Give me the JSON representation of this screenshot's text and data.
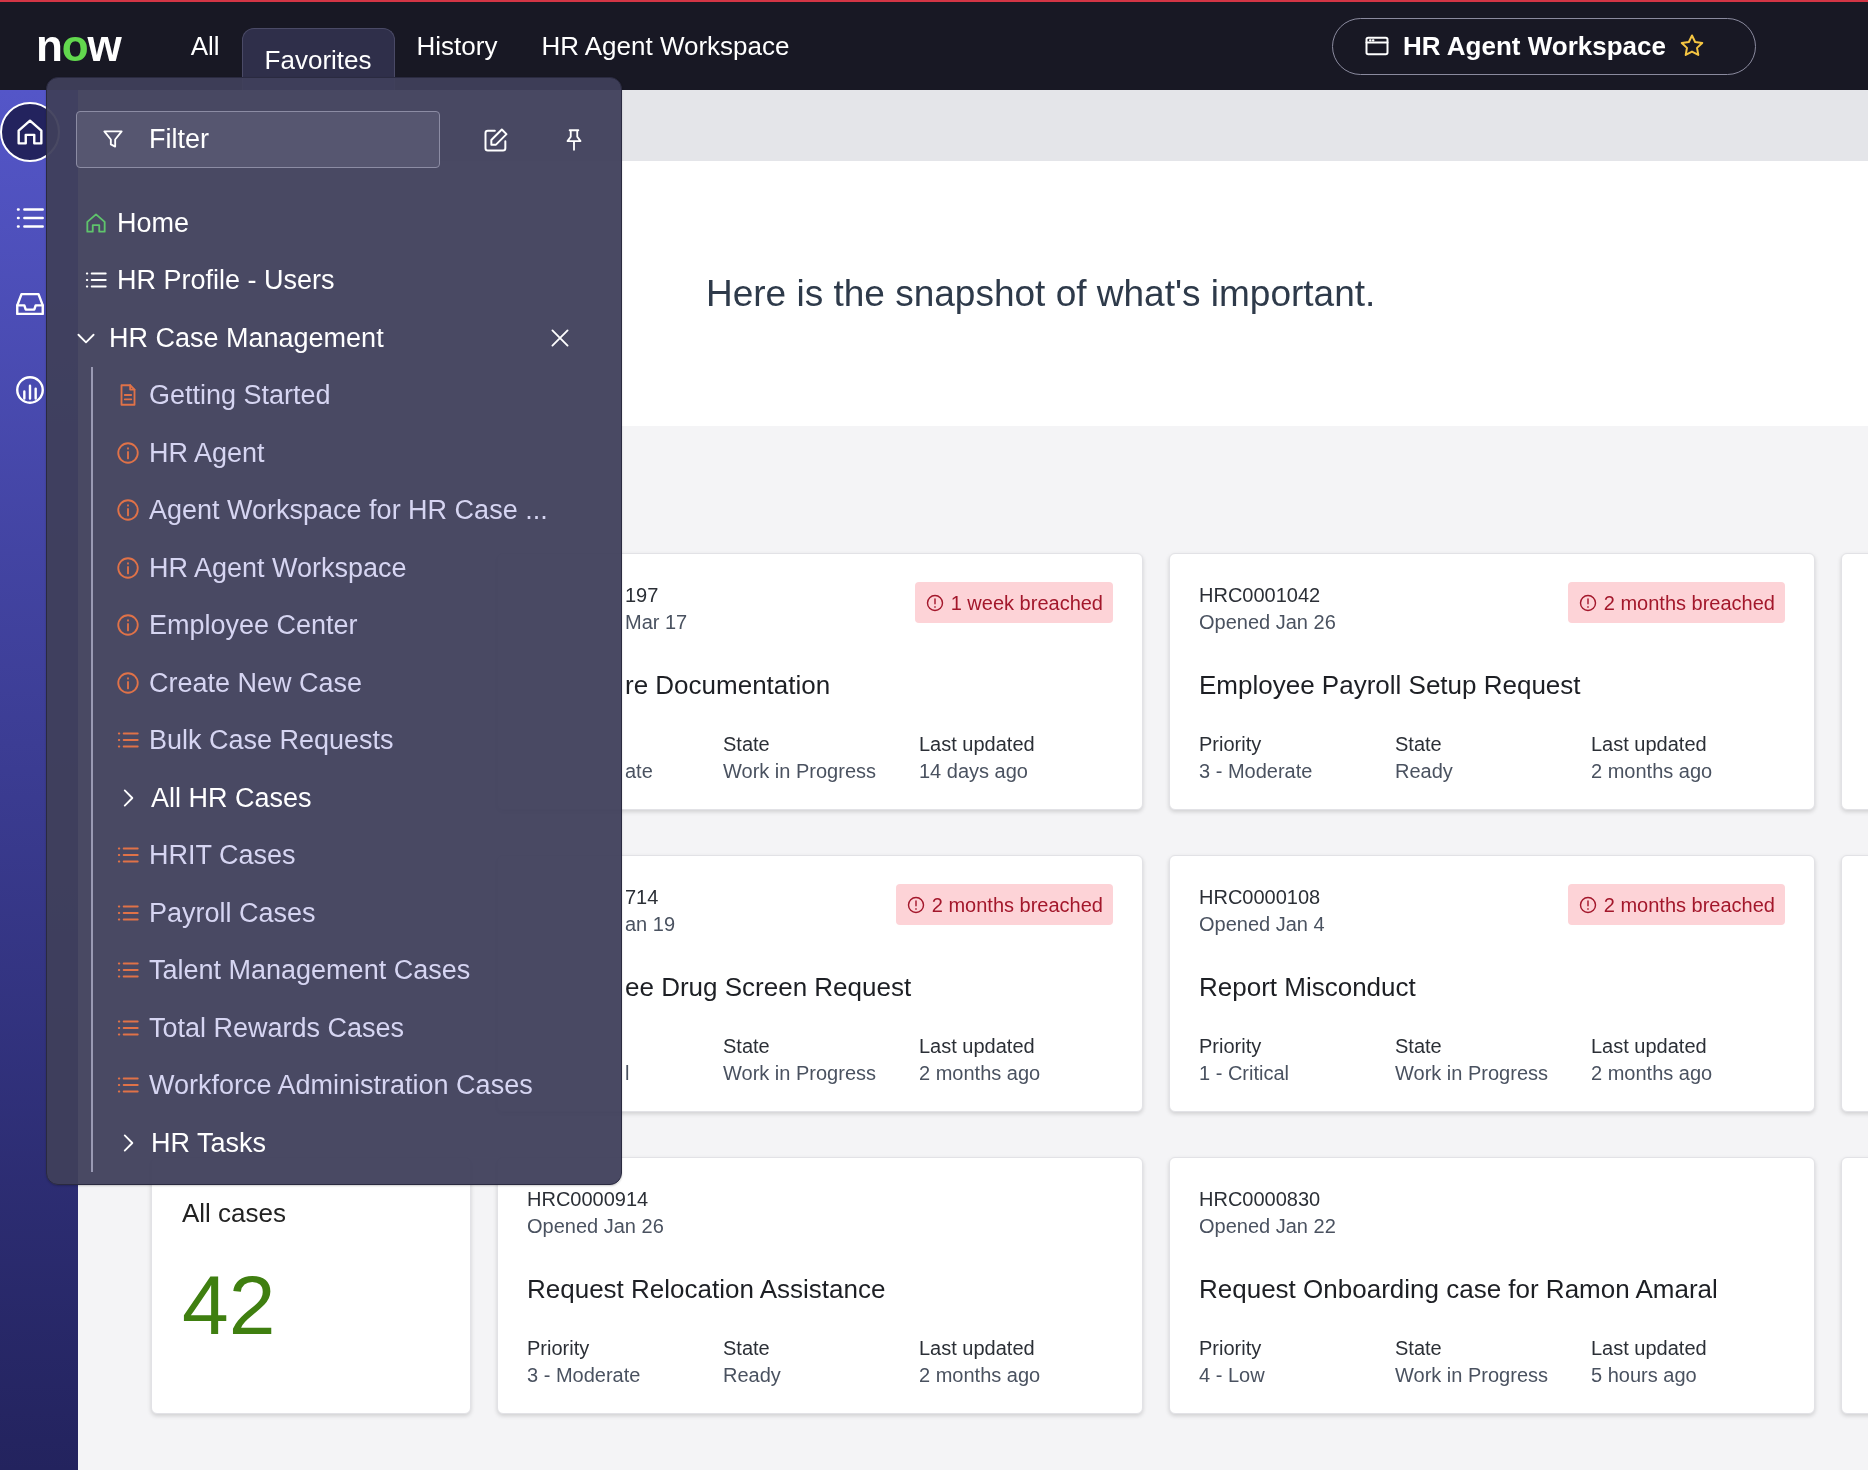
{
  "nav": {
    "logo": "now",
    "tabs": [
      {
        "label": "All",
        "selected": false
      },
      {
        "label": "Favorites",
        "selected": true
      },
      {
        "label": "History",
        "selected": false
      },
      {
        "label": "HR Agent Workspace",
        "selected": false
      }
    ],
    "workspace_button": {
      "label": "HR Agent Workspace"
    }
  },
  "rail_items": [
    {
      "kind": "home",
      "selected": true
    },
    {
      "kind": "list",
      "selected": false
    },
    {
      "kind": "inbox",
      "selected": false
    },
    {
      "kind": "chart",
      "selected": false
    }
  ],
  "hero": {
    "text": "Here is the snapshot of what's important."
  },
  "card_rows": [
    {
      "cards": [
        {
          "kind": "case",
          "number": "197",
          "opened": "Mar 17",
          "breach": "1 week breached",
          "title": "re Documentation",
          "fields": [
            {
              "value": "ate"
            },
            {
              "label": "State",
              "value": "Work in Progress"
            },
            {
              "label": "Last updated",
              "value": "14 days ago"
            }
          ]
        },
        {
          "kind": "case",
          "number": "HRC0001042",
          "opened": "Opened Jan 26",
          "breach": "2 months breached",
          "title": "Employee Payroll Setup Request",
          "fields": [
            {
              "label": "Priority",
              "value": "3 - Moderate"
            },
            {
              "label": "State",
              "value": "Ready"
            },
            {
              "label": "Last updated",
              "value": "2 months ago"
            }
          ]
        }
      ]
    },
    {
      "cards": [
        {
          "kind": "case",
          "number": "714",
          "opened": "an 19",
          "breach": "2 months breached",
          "title": "ee Drug Screen Request",
          "fields": [
            {
              "value": "l"
            },
            {
              "label": "State",
              "value": "Work in Progress"
            },
            {
              "label": "Last updated",
              "value": "2 months ago"
            }
          ]
        },
        {
          "kind": "case",
          "number": "HRC0000108",
          "opened": "Opened Jan 4",
          "breach": "2 months breached",
          "title": "Report Misconduct",
          "fields": [
            {
              "label": "Priority",
              "value": "1 - Critical"
            },
            {
              "label": "State",
              "value": "Work in Progress"
            },
            {
              "label": "Last updated",
              "value": "2 months ago"
            }
          ]
        }
      ]
    },
    {
      "cards": [
        {
          "kind": "count",
          "label": "All cases",
          "count": "42"
        },
        {
          "kind": "case",
          "number": "HRC0000914",
          "opened": "Opened Jan 26",
          "title": "Request Relocation Assistance",
          "fields": [
            {
              "label": "Priority",
              "value": "3 - Moderate"
            },
            {
              "label": "State",
              "value": "Ready"
            },
            {
              "label": "Last updated",
              "value": "2 months ago"
            }
          ]
        },
        {
          "kind": "case",
          "number": "HRC0000830",
          "opened": "Opened Jan 22",
          "title": "Request Onboarding case for Ramon Amaral",
          "fields": [
            {
              "label": "Priority",
              "value": "4 - Low"
            },
            {
              "label": "State",
              "value": "Work in Progress"
            },
            {
              "label": "Last updated",
              "value": "5 hours ago"
            }
          ]
        }
      ]
    }
  ],
  "menu": {
    "filter": {
      "placeholder": "Filter"
    },
    "items": [
      {
        "kind": "home",
        "label": "Home"
      },
      {
        "kind": "list",
        "label": "HR Profile - Users"
      },
      {
        "kind": "group",
        "label": "HR Case Management",
        "expanded": true,
        "children": [
          {
            "kind": "document",
            "label": "Getting Started"
          },
          {
            "kind": "info",
            "label": "HR Agent"
          },
          {
            "kind": "info",
            "label": "Agent Workspace for HR Case ..."
          },
          {
            "kind": "info",
            "label": "HR Agent Workspace"
          },
          {
            "kind": "info",
            "label": "Employee Center"
          },
          {
            "kind": "info",
            "label": "Create New Case"
          },
          {
            "kind": "list",
            "label": "Bulk Case Requests"
          },
          {
            "kind": "group",
            "label": "All HR Cases",
            "expanded": false
          },
          {
            "kind": "list",
            "label": "HRIT Cases"
          },
          {
            "kind": "list",
            "label": "Payroll Cases"
          },
          {
            "kind": "list",
            "label": "Talent Management Cases"
          },
          {
            "kind": "list",
            "label": "Total Rewards Cases"
          },
          {
            "kind": "list",
            "label": "Workforce Administration Cases"
          },
          {
            "kind": "group",
            "label": "HR Tasks",
            "expanded": false
          }
        ]
      }
    ]
  }
}
